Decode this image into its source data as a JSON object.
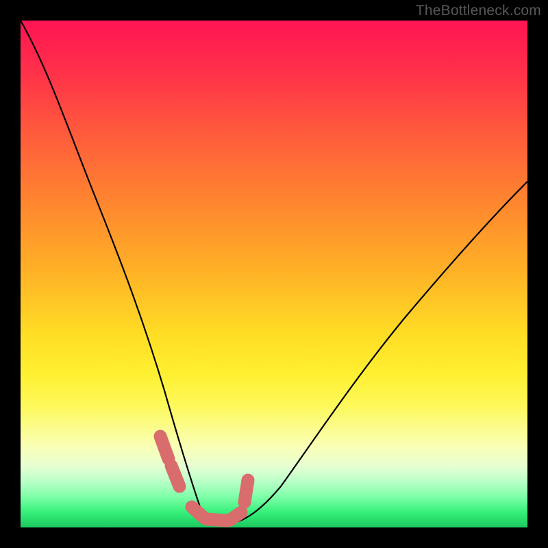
{
  "watermark": "TheBottleneck.com",
  "chart_data": {
    "type": "line",
    "title": "",
    "xlabel": "",
    "ylabel": "",
    "x_range_percent": [
      0,
      100
    ],
    "y_range_percent": [
      0,
      100
    ],
    "description": "V-shaped bottleneck curve on rainbow gradient background; higher position = worse deviation; bottom green band = optimal.",
    "series": [
      {
        "name": "bottleneck-curve",
        "x_percent": [
          0,
          4,
          8,
          12,
          16,
          20,
          24,
          28,
          30,
          32.5,
          35,
          37,
          40,
          45,
          52,
          60,
          70,
          82,
          100
        ],
        "y_percent": [
          100,
          92,
          83,
          73,
          62,
          51,
          39,
          26,
          18,
          10,
          4,
          1,
          0.5,
          2,
          8,
          17,
          29,
          41,
          56
        ]
      }
    ],
    "markers": {
      "name": "highlighted-range",
      "color": "#d96d6d",
      "x_percent": [
        27.5,
        29.5,
        31,
        33,
        35,
        37,
        39,
        40.5,
        42,
        43.5,
        44.5
      ],
      "y_percent": [
        18,
        13,
        9,
        5,
        3,
        1.5,
        1.2,
        1.5,
        3,
        6,
        10
      ]
    },
    "gradient_bands": [
      {
        "label": "red-worst",
        "y_percent_range": [
          70,
          100
        ]
      },
      {
        "label": "orange",
        "y_percent_range": [
          40,
          70
        ]
      },
      {
        "label": "yellow",
        "y_percent_range": [
          15,
          40
        ]
      },
      {
        "label": "green-best",
        "y_percent_range": [
          0,
          15
        ]
      }
    ]
  }
}
